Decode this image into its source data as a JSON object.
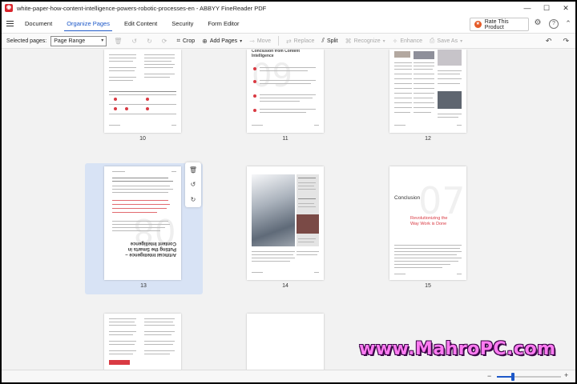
{
  "window": {
    "title": "white-paper-how-content-intelligence-powers-robotic-processes-en - ABBYY FineReader PDF",
    "controls": [
      "—",
      "☐",
      "✕"
    ]
  },
  "menu": {
    "tabs": [
      "Document",
      "Organize Pages",
      "Edit Content",
      "Security",
      "Form Editor"
    ],
    "active_tab": "Organize Pages",
    "rate_button": "Rate This Product"
  },
  "toolbar": {
    "selected_pages_label": "Selected pages:",
    "selected_pages_value": "Page Range",
    "crop": "Crop",
    "add_pages": "Add Pages",
    "move": "Move",
    "replace": "Replace",
    "split": "Split",
    "recognize": "Recognize",
    "enhance": "Enhance",
    "save_as": "Save As"
  },
  "pages": [
    {
      "number": "10"
    },
    {
      "number": "11",
      "heading": "Conclusion from Content Intelligence"
    },
    {
      "number": "12"
    },
    {
      "number": "13",
      "heading": "Artificial Intelligence – Putting the Smarts in Content Intelligence",
      "rotated": true,
      "selected": true
    },
    {
      "number": "14"
    },
    {
      "number": "15",
      "heading": "Conclusion",
      "subheading": "Revolutionizing the Way Work is Done"
    },
    {
      "number": ""
    },
    {
      "number": ""
    }
  ],
  "watermark": "www.MahroPC.com",
  "zoom": {
    "level": 0.25
  },
  "colors": {
    "accent": "#1d58c8",
    "brand": "#d9252c",
    "selection": "#d8e3f5"
  }
}
